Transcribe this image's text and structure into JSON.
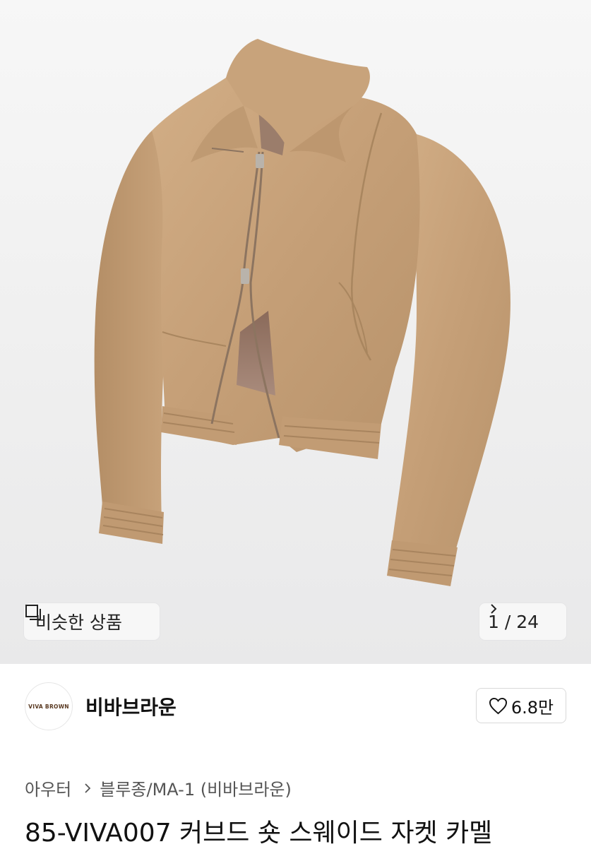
{
  "gallery": {
    "similar_label": "비슷한 상품",
    "counter": "1 / 24",
    "image_subject": "product-photo-camel-suede-jacket"
  },
  "seller": {
    "logo_text": "VIVA BROWN",
    "name": "비바브라운",
    "likes": "6.8만"
  },
  "breadcrumb": {
    "category": "아우터",
    "subcategory": "블루종/MA-1 (비바브라운)"
  },
  "product": {
    "title": "85-VIVA007 커브드 숏 스웨이드 자켓 카멜"
  },
  "colors": {
    "jacket": "#c7a27a",
    "background": "#efefef",
    "logo_text": "#5a3a22"
  }
}
